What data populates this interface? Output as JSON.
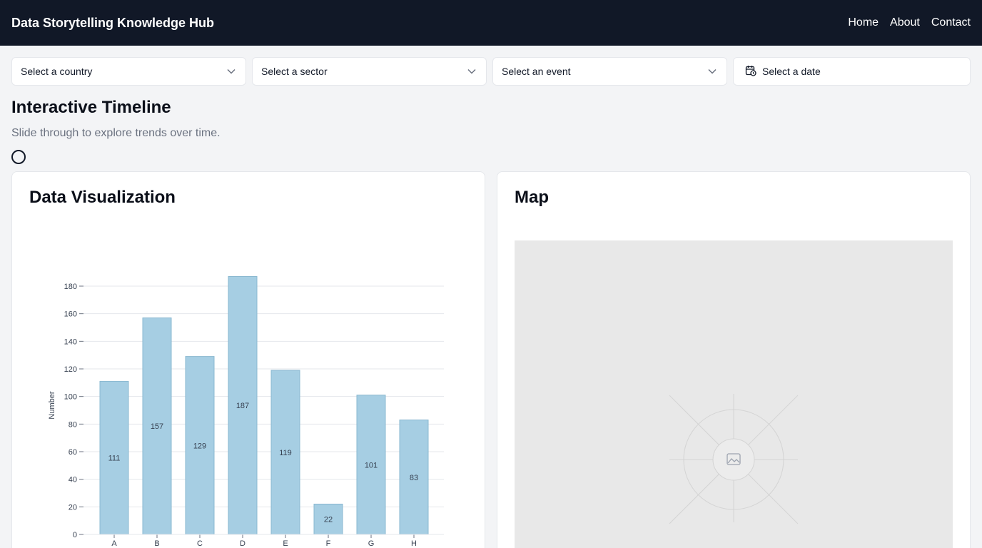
{
  "header": {
    "title": "Data Storytelling Knowledge Hub",
    "nav": [
      "Home",
      "About",
      "Contact"
    ]
  },
  "filters": {
    "country": "Select a country",
    "sector": "Select a sector",
    "event": "Select an event",
    "date": "Select a date"
  },
  "timeline": {
    "title": "Interactive Timeline",
    "subtitle": "Slide through to explore trends over time."
  },
  "viz": {
    "title": "Data Visualization"
  },
  "map": {
    "title": "Map",
    "placeholder_icon": "image-icon"
  },
  "colors": {
    "header_bg": "#111827",
    "bar_fill": "#a6cee3",
    "bar_stroke": "#8ab8d0"
  },
  "chart_data": {
    "type": "bar",
    "categories": [
      "A",
      "B",
      "C",
      "D",
      "E",
      "F",
      "G",
      "H"
    ],
    "values": [
      111,
      157,
      129,
      187,
      119,
      22,
      101,
      83
    ],
    "title": "",
    "xlabel": "",
    "ylabel": "Number",
    "ylim": [
      0,
      180
    ],
    "yticks": [
      0,
      20,
      40,
      60,
      80,
      100,
      120,
      140,
      160,
      180
    ],
    "grid": true
  }
}
